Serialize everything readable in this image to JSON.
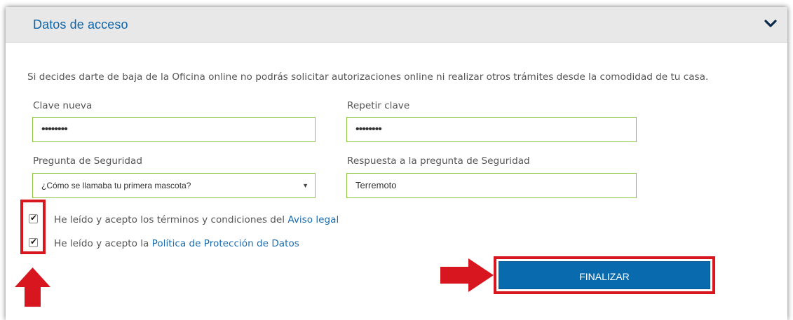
{
  "section": {
    "title": "Datos de acceso",
    "intro": "Si decides darte de baja de la Oficina online no podrás solicitar autorizaciones online ni realizar otros trámites desde la comodidad de tu casa."
  },
  "form": {
    "new_password": {
      "label": "Clave nueva",
      "value": "••••••••"
    },
    "repeat_password": {
      "label": "Repetir clave",
      "value": "••••••••"
    },
    "security_question": {
      "label": "Pregunta de Seguridad",
      "selected": "¿Cómo se llamaba tu primera mascota?"
    },
    "security_answer": {
      "label": "Respuesta a la pregunta de Seguridad",
      "value": "Terremoto"
    }
  },
  "checks": {
    "terms": {
      "text": "He leído y acepto los términos y condiciones del ",
      "link": "Aviso legal",
      "checked": true
    },
    "privacy": {
      "text": "He leído y acepto la ",
      "link": "Política de Protección de Datos",
      "checked": true
    }
  },
  "buttons": {
    "submit_label": "FINALIZAR"
  },
  "icons": {
    "header_toggle": "chevron-down-icon",
    "annotation_up": "red-arrow-up-icon",
    "annotation_right": "red-arrow-right-icon"
  },
  "colors": {
    "title": "#0f65a8",
    "field_border": "#8cc63f",
    "link": "#1a6cb0",
    "button": "#0a6aae",
    "annotation": "#d8161f"
  }
}
